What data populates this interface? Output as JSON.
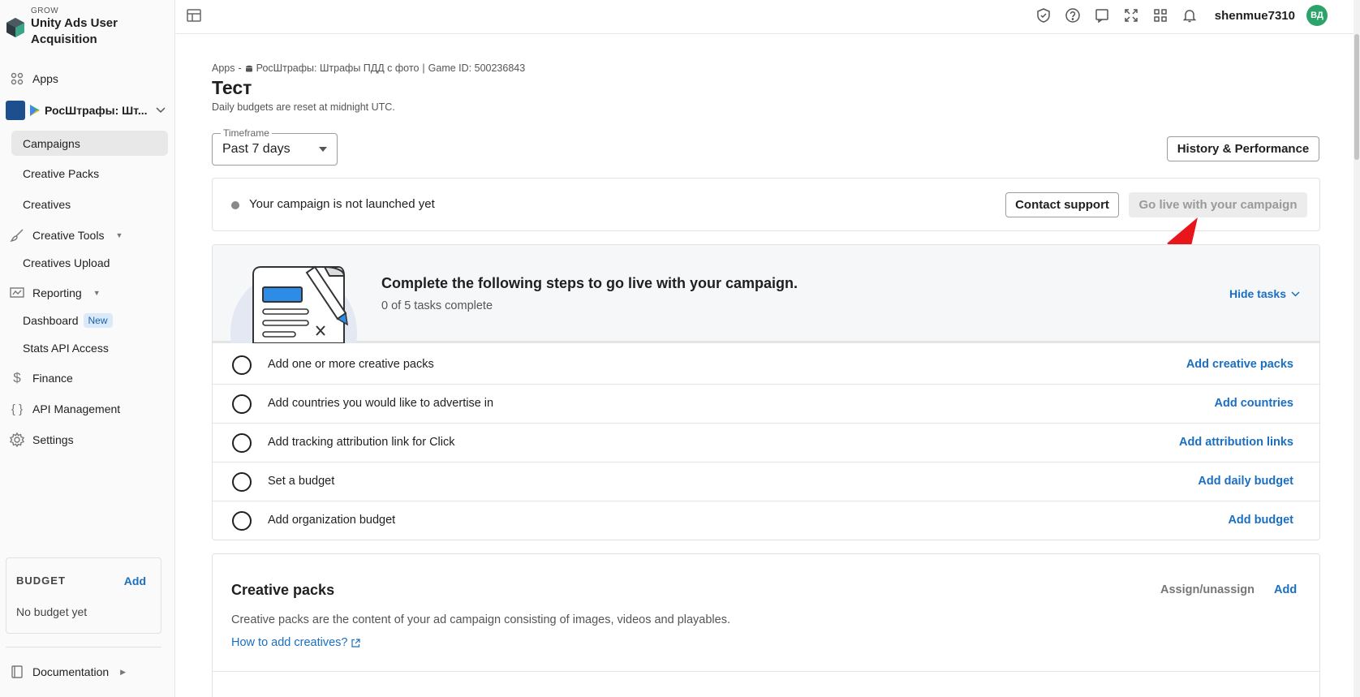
{
  "brand": {
    "small": "GROW",
    "title": "Unity Ads User Acquisition"
  },
  "sidebar": {
    "apps": "Apps",
    "app_name": "РосШтрафы: Шт...",
    "campaigns": "Campaigns",
    "creative_packs": "Creative Packs",
    "creatives": "Creatives",
    "creative_tools": "Creative Tools",
    "creatives_upload": "Creatives Upload",
    "reporting": "Reporting",
    "dashboard": "Dashboard",
    "new_badge": "New",
    "stats_api": "Stats API Access",
    "finance": "Finance",
    "api_management": "API Management",
    "settings": "Settings",
    "documentation": "Documentation"
  },
  "budget": {
    "title": "BUDGET",
    "add": "Add",
    "empty": "No budget yet"
  },
  "topbar": {
    "username": "shenmue7310",
    "avatar": "ВД"
  },
  "breadcrumb": {
    "apps": "Apps",
    "separator": "-",
    "app": "РосШтрафы: Штрафы ПДД с фото",
    "divider": "|",
    "game_id": "Game ID: 500236843"
  },
  "page": {
    "title": "Тест",
    "subtitle": "Daily budgets are reset at midnight UTC."
  },
  "timeframe": {
    "label": "Timeframe",
    "value": "Past 7 days"
  },
  "history_button": "History & Performance",
  "status": {
    "text": "Your campaign is not launched yet",
    "contact": "Contact support",
    "go_live": "Go live with your campaign"
  },
  "steps": {
    "title": "Complete the following steps to go live with your campaign.",
    "count": "0 of 5 tasks complete",
    "hide": "Hide tasks",
    "tasks": [
      {
        "label": "Add one or more creative packs",
        "action": "Add creative packs"
      },
      {
        "label": "Add countries you would like to advertise in",
        "action": "Add countries"
      },
      {
        "label": "Add tracking attribution link for Click",
        "action": "Add attribution links"
      },
      {
        "label": "Set a budget",
        "action": "Add daily budget"
      },
      {
        "label": "Add organization budget",
        "action": "Add budget"
      }
    ]
  },
  "packs": {
    "title": "Creative packs",
    "assign": "Assign/unassign",
    "add": "Add",
    "description": "Creative packs are the content of your ad campaign consisting of images, videos and playables.",
    "link": "How to add creatives?"
  },
  "colors": {
    "accent": "#1a6fc2",
    "avatar": "#2ca36a",
    "arrow": "#e8151b"
  }
}
